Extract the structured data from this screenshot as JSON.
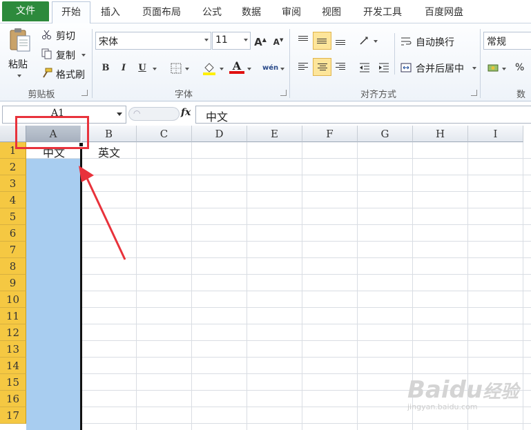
{
  "tabs": {
    "file": "文件",
    "home": "开始",
    "insert": "插入",
    "page_layout": "页面布局",
    "formulas": "公式",
    "data": "数据",
    "review": "审阅",
    "view": "视图",
    "developer": "开发工具",
    "baidu_pan": "百度网盘"
  },
  "ribbon": {
    "clipboard": {
      "paste": "粘贴",
      "cut": "剪切",
      "copy": "复制",
      "format_painter": "格式刷",
      "label": "剪贴板"
    },
    "font": {
      "font_name": "宋体",
      "font_size": "11",
      "bold": "B",
      "italic": "I",
      "underline": "U",
      "grow": "A",
      "shrink": "A",
      "font_color_letter": "A",
      "phonetic": "wén",
      "label": "字体"
    },
    "alignment": {
      "wrap_text": "自动换行",
      "merge_center": "合并后居中",
      "label": "对齐方式"
    },
    "number": {
      "format": "常规",
      "percent": "%",
      "label": "数"
    }
  },
  "formula_bar": {
    "name_box": "A1",
    "fx": "fx",
    "content": "中文"
  },
  "grid": {
    "columns": [
      "A",
      "B",
      "C",
      "D",
      "E",
      "F",
      "G",
      "H",
      "I"
    ],
    "rows": [
      "1",
      "2",
      "3",
      "4",
      "5",
      "6",
      "7",
      "8",
      "9",
      "10",
      "11",
      "12",
      "13",
      "14",
      "15",
      "16",
      "17"
    ],
    "cells": {
      "A1": "中文",
      "B1": "英文"
    }
  },
  "watermark": {
    "brand": "Bai",
    "brand2": "经验",
    "url": "jingyan.baidu.com"
  },
  "colors": {
    "file_tab": "#2d8a3c",
    "row_header_selected": "#f5c842",
    "selection_fill": "#a8cdf0",
    "callout": "#e8323b"
  }
}
